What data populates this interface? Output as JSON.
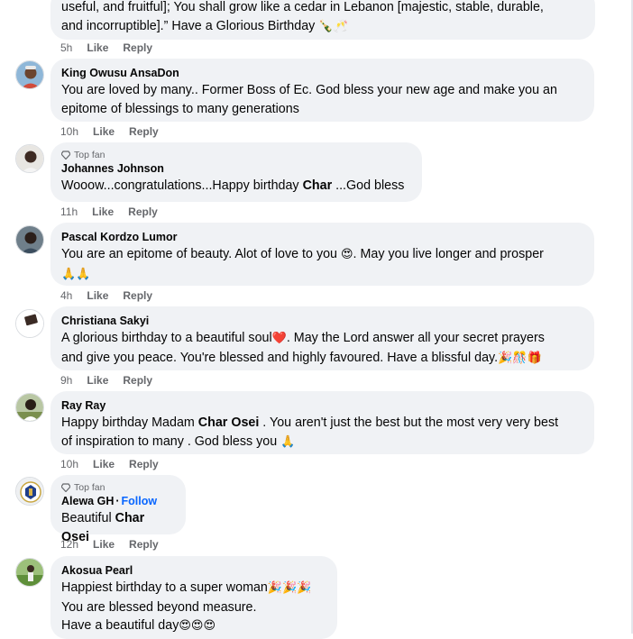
{
  "comments": [
    {
      "text_line1": "useful, and fruitful]; You shall grow like a cedar in Lebanon [majestic, stable, durable,",
      "text_line2": "and incorruptible].” Have a Glorious Birthday",
      "emoji": "🍾🥂",
      "time": "5h",
      "like": "Like",
      "reply": "Reply"
    },
    {
      "author": "King Owusu AnsaDon",
      "text_line1": "You are loved by many.. Former Boss of Ec. God bless your new age and make you an",
      "text_line2": "epitome of blessings to many generations",
      "time": "10h",
      "like": "Like",
      "reply": "Reply"
    },
    {
      "badge": "Top fan",
      "author": "Johannes Johnson",
      "text_before": "Wooow...congratulations...Happy birthday ",
      "text_bold": "Char",
      "text_after": " ...God bless",
      "time": "11h",
      "like": "Like",
      "reply": "Reply"
    },
    {
      "author": "Pascal Kordzo Lumor",
      "text_line1a": "You are an epitome of beauty. Alot of love to you ",
      "emoji1": "😍",
      "text_line1b": ". May you live longer and prosper",
      "emoji2": "🙏🙏",
      "time": "4h",
      "like": "Like",
      "reply": "Reply"
    },
    {
      "author": "Christiana Sakyi",
      "text_line1a": "A glorious birthday to a beautiful soul",
      "emoji1": "❤️",
      "text_line1b": ". May the Lord answer all your secret prayers",
      "text_line2": "and give you peace. You're blessed and highly favoured. Have a blissful day.",
      "emoji2": "🎉🎊🎁",
      "time": "9h",
      "like": "Like",
      "reply": "Reply"
    },
    {
      "author": "Ray Ray",
      "text_line1a": "Happy birthday Madam ",
      "text_bold": "Char Osei",
      "text_line1b": " . You aren't just the best but the most very very best",
      "text_line2": "of inspiration to many . God bless you ",
      "emoji": "🙏",
      "time": "10h",
      "like": "Like",
      "reply": "Reply"
    },
    {
      "badge": "Top fan",
      "author": "Alewa GH",
      "follow": "Follow",
      "text_before": "Beautiful ",
      "text_bold": "Char Osei",
      "time": "12h",
      "like": "Like",
      "reply": "Reply"
    },
    {
      "author": "Akosua Pearl",
      "text_line1": "Happiest birthday to a super woman",
      "emoji1": "🎉🎉🎉",
      "text_line2": "You are blessed beyond measure.",
      "text_line3": "Have a beautiful day",
      "emoji3": "😍😍😍"
    }
  ]
}
